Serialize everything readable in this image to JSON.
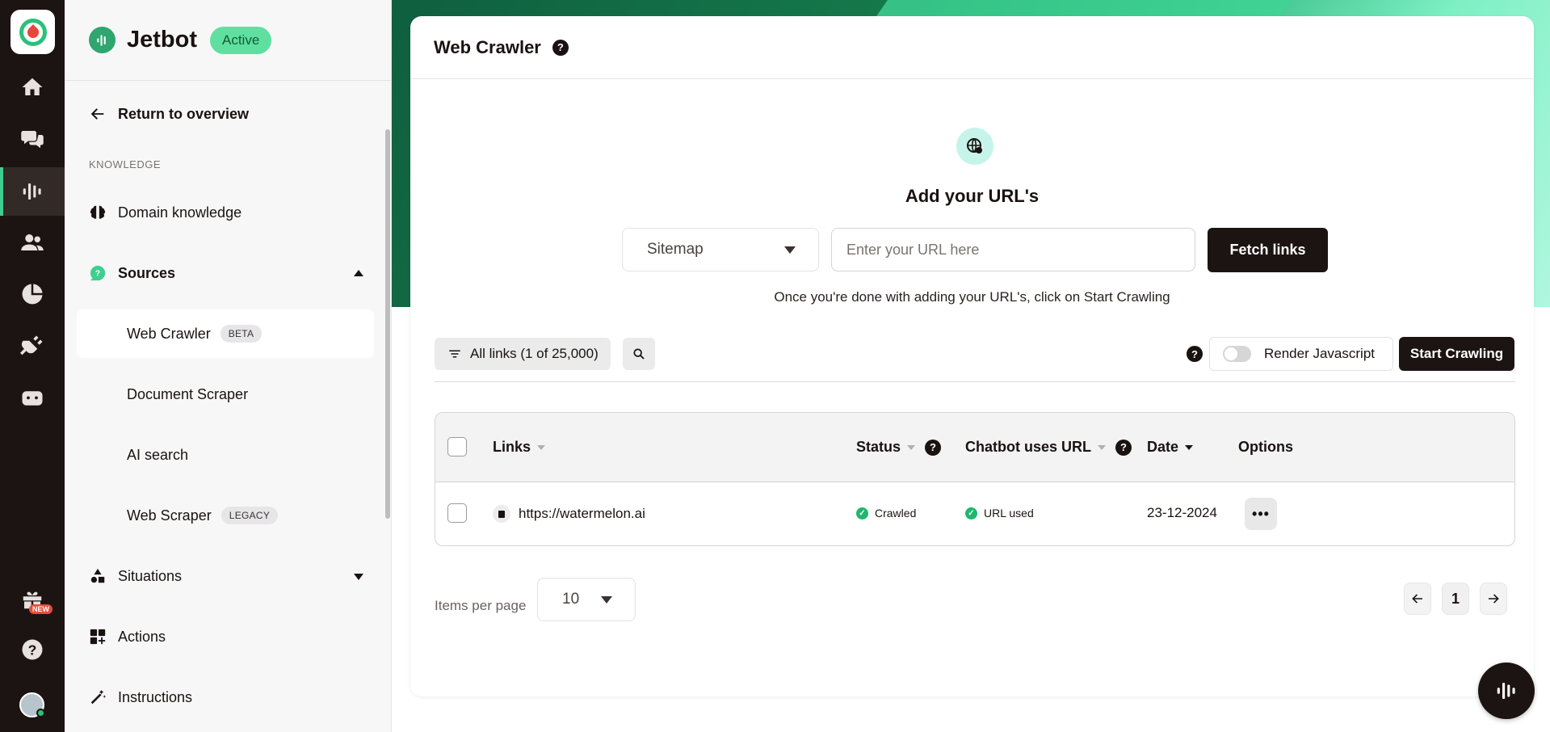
{
  "rail": {
    "new_badge": "NEW"
  },
  "sidebar": {
    "bot_name": "Jetbot",
    "bot_status": "Active",
    "back_label": "Return to overview",
    "section_label": "KNOWLEDGE",
    "domain_knowledge": "Domain knowledge",
    "sources": "Sources",
    "sub_items": [
      {
        "label": "Web Crawler",
        "tag": "BETA"
      },
      {
        "label": "Document Scraper"
      },
      {
        "label": "AI search"
      },
      {
        "label": "Web Scraper",
        "tag": "LEGACY"
      }
    ],
    "situations": "Situations",
    "actions": "Actions",
    "instructions": "Instructions"
  },
  "main": {
    "title": "Web Crawler",
    "help_glyph": "?",
    "add_title": "Add your URL's",
    "source_select": "Sitemap",
    "url_placeholder": "Enter your URL here",
    "fetch_label": "Fetch links",
    "hint": "Once you're done with adding your URL's, click on Start Crawling",
    "filter_label": "All links (1 of 25,000)",
    "render_js_label": "Render Javascript",
    "start_label": "Start Crawling"
  },
  "table": {
    "headers": {
      "links": "Links",
      "status": "Status",
      "chatbot": "Chatbot uses URL",
      "date": "Date",
      "options": "Options"
    },
    "rows": [
      {
        "url": "https://watermelon.ai",
        "status": "Crawled",
        "chatbot": "URL used",
        "date": "23-12-2024",
        "more": "•••"
      }
    ]
  },
  "pagination": {
    "items_per_page_label": "Items per page",
    "items_per_page": "10",
    "current_page": "1"
  },
  "colors": {
    "rail_bg": "#1c1412",
    "accent_green": "#3ecf8e",
    "badge_green": "#5fe0a0",
    "status_green": "#1fb76d"
  }
}
